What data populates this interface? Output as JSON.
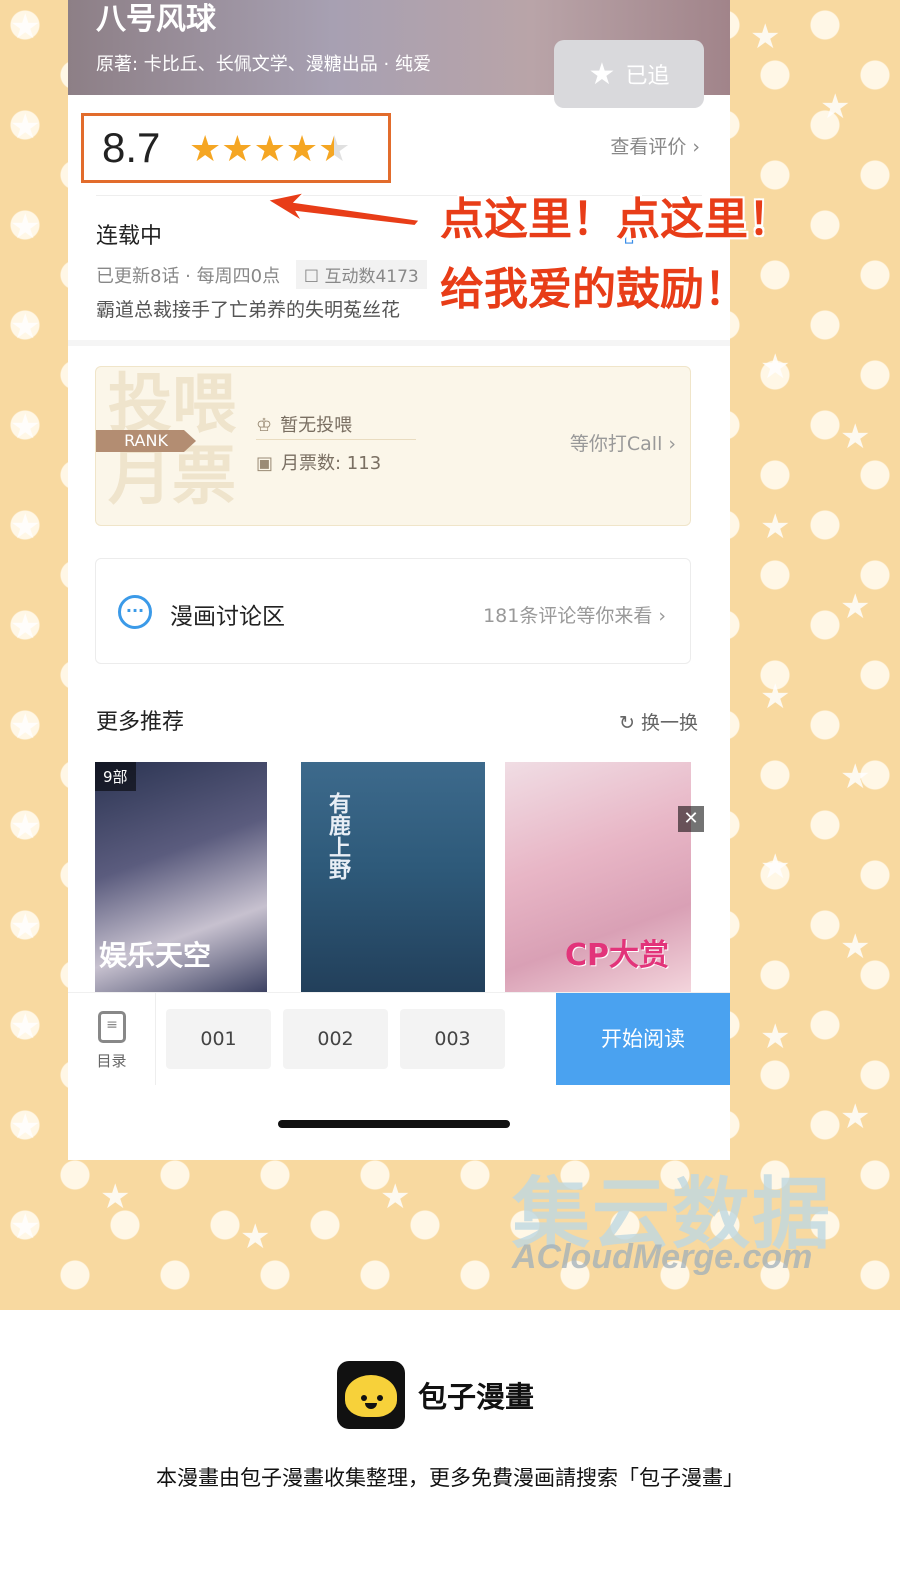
{
  "comic": {
    "title": "八号风球",
    "meta": "原著: 卡比丘、长佩文学、漫糖出品  ·  纯爱",
    "follow_label": "已追"
  },
  "rating": {
    "score": "8.7",
    "stars_value": 4.5,
    "stars_max": 5,
    "view_label": "查看评价 ›"
  },
  "info": {
    "status": "连载中",
    "update": "已更新8话 · 每周四0点",
    "interaction": "互动数4173",
    "summary": "霸道总裁接手了亡弟养的失明菟丝花"
  },
  "rank": {
    "big_text": "投喂\n月票",
    "tag": "RANK",
    "line1": "暂无投喂",
    "line2": "月票数: 113",
    "call": "等你打Call ›"
  },
  "discussion": {
    "label": "漫画讨论区",
    "count": "181条评论等你来看 ›"
  },
  "recommend": {
    "title": "更多推荐",
    "refresh": "换一换",
    "covers": [
      {
        "badge": "9部",
        "text": "娱乐天空"
      },
      {
        "badge": "",
        "text": "有鹿上野"
      },
      {
        "badge": "",
        "text": "CP大赏"
      }
    ]
  },
  "bottom_bar": {
    "toc_label": "目录",
    "chapters": [
      "001",
      "002",
      "003"
    ],
    "start_label": "开始阅读"
  },
  "annotation": {
    "line1": "点这里！点这里！",
    "line2": "给我爱的鼓励！"
  },
  "watermark": {
    "cn": "集云数据",
    "en": "ACloudMerge.com"
  },
  "footer": {
    "brand": "包子漫畫",
    "note": "本漫畫由包子漫畫收集整理，更多免費漫画請搜索「包子漫畫」"
  },
  "colors": {
    "accent_orange": "#e26c2c",
    "star": "#f5a623",
    "blue": "#4aa2f0",
    "annotation_red": "#e83d18"
  }
}
